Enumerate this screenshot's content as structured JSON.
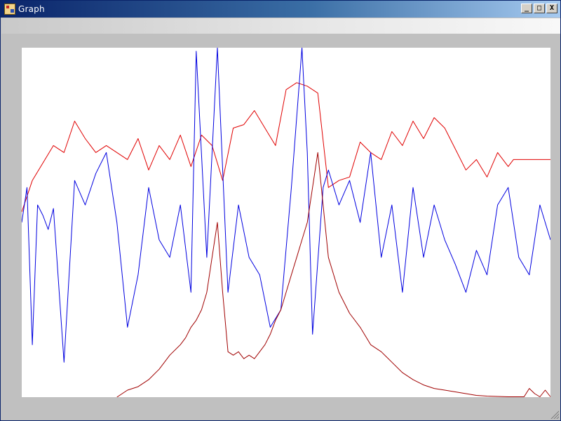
{
  "window": {
    "title": "Graph",
    "buttons": {
      "minimize": "_",
      "maximize": "□",
      "close": "X"
    }
  },
  "chart_data": {
    "type": "line",
    "title": "",
    "xlabel": "",
    "ylabel": "",
    "grid": false,
    "legend": "none",
    "xlim": [
      0,
      100
    ],
    "ylim": [
      0,
      100
    ],
    "colors": {
      "red_series": "#e00000",
      "blue_series": "#0000e0",
      "dark_red_series": "#a00000"
    },
    "series": [
      {
        "color": "#e00000",
        "x": [
          0,
          2,
          4,
          6,
          8,
          10,
          12,
          14,
          16,
          18,
          20,
          22,
          24,
          26,
          28,
          30,
          32,
          34,
          36,
          38,
          40,
          42,
          44,
          46,
          48,
          50,
          52,
          54,
          56,
          58,
          60,
          62,
          64,
          66,
          68,
          70,
          72,
          74,
          76,
          78,
          80,
          82,
          84,
          86,
          88,
          90,
          92,
          93,
          95,
          97,
          100
        ],
        "y": [
          53,
          62,
          67,
          72,
          70,
          79,
          74,
          70,
          72,
          70,
          68,
          74,
          65,
          72,
          68,
          75,
          66,
          75,
          72,
          62,
          77,
          78,
          82,
          77,
          72,
          88,
          90,
          89,
          87,
          60,
          62,
          63,
          73,
          70,
          68,
          76,
          72,
          79,
          74,
          80,
          77,
          71,
          65,
          68,
          63,
          70,
          66,
          68,
          68,
          68,
          68
        ]
      },
      {
        "color": "#0000e0",
        "x": [
          0,
          1,
          2,
          3,
          4,
          5,
          6,
          8,
          10,
          12,
          14,
          16,
          18,
          20,
          22,
          24,
          26,
          28,
          30,
          32,
          33,
          35,
          37,
          39,
          41,
          43,
          45,
          47,
          49,
          51,
          53,
          54,
          55,
          57,
          58,
          60,
          62,
          64,
          66,
          68,
          70,
          72,
          74,
          76,
          78,
          80,
          82,
          84,
          86,
          88,
          90,
          92,
          94,
          96,
          98,
          100
        ],
        "y": [
          50,
          60,
          15,
          55,
          52,
          48,
          54,
          10,
          62,
          55,
          64,
          70,
          50,
          20,
          35,
          60,
          45,
          40,
          55,
          30,
          99,
          40,
          100,
          30,
          55,
          40,
          35,
          20,
          25,
          60,
          100,
          70,
          18,
          60,
          65,
          55,
          62,
          50,
          70,
          40,
          55,
          30,
          60,
          40,
          55,
          45,
          38,
          30,
          42,
          35,
          55,
          60,
          40,
          35,
          55,
          45
        ]
      },
      {
        "color": "#a00000",
        "x": [
          18,
          20,
          22,
          24,
          26,
          28,
          30,
          31,
          32,
          33,
          34,
          35,
          36,
          37,
          38,
          39,
          40,
          41,
          42,
          43,
          44,
          45,
          46,
          47,
          48,
          49,
          50,
          51,
          52,
          53,
          54,
          55,
          56,
          58,
          60,
          62,
          64,
          66,
          68,
          70,
          72,
          74,
          76,
          78,
          80,
          82,
          84,
          86,
          88,
          90,
          92,
          94,
          95,
          96,
          97,
          98,
          99,
          100
        ],
        "y": [
          0,
          2,
          3,
          5,
          8,
          12,
          15,
          17,
          20,
          22,
          25,
          30,
          40,
          50,
          30,
          13,
          12,
          13,
          11,
          12,
          11,
          13,
          15,
          18,
          22,
          25,
          30,
          35,
          40,
          45,
          50,
          60,
          70,
          40,
          30,
          24,
          20,
          15,
          13,
          10,
          7,
          5,
          3.5,
          2.5,
          2,
          1.5,
          1,
          0.5,
          0.3,
          0.2,
          0.1,
          0.1,
          0.1,
          2.5,
          1,
          0.1,
          2,
          0.1
        ]
      }
    ]
  }
}
